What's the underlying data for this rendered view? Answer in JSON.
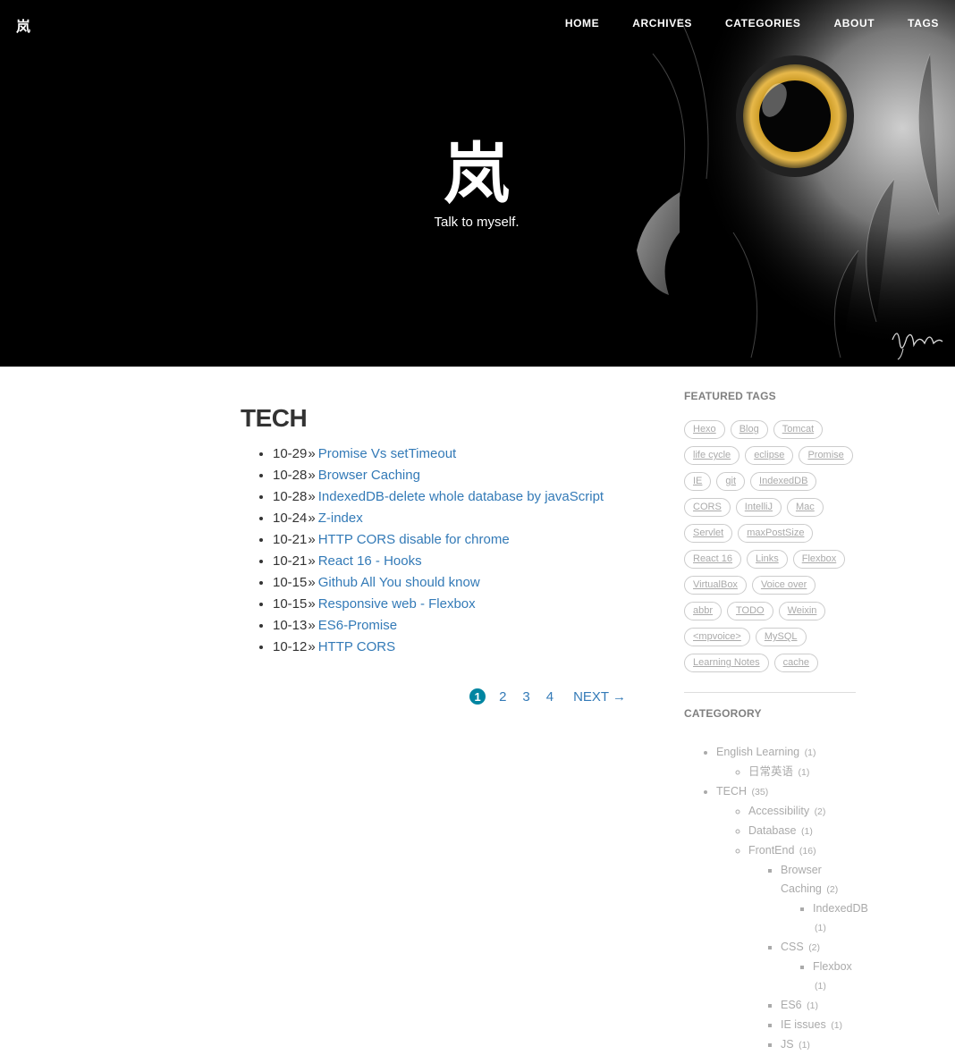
{
  "header": {
    "brand": "岚",
    "nav": [
      "HOME",
      "ARCHIVES",
      "CATEGORIES",
      "ABOUT",
      "TAGS"
    ],
    "title": "岚",
    "subtitle": "Talk to myself."
  },
  "main": {
    "heading": "TECH",
    "posts": [
      {
        "date": "10-29",
        "title": "Promise Vs setTimeout"
      },
      {
        "date": "10-28",
        "title": "Browser Caching"
      },
      {
        "date": "10-28",
        "title": "IndexedDB-delete whole database by javaScript"
      },
      {
        "date": "10-24",
        "title": "Z-index"
      },
      {
        "date": "10-21",
        "title": "HTTP CORS disable for chrome"
      },
      {
        "date": "10-21",
        "title": "React 16 - Hooks"
      },
      {
        "date": "10-15",
        "title": "Github All You should know"
      },
      {
        "date": "10-15",
        "title": "Responsive web - Flexbox"
      },
      {
        "date": "10-13",
        "title": "ES6-Promise"
      },
      {
        "date": "10-12",
        "title": "HTTP CORS"
      }
    ],
    "separator": "»"
  },
  "pagination": {
    "current": "1",
    "pages": [
      "2",
      "3",
      "4"
    ],
    "next": "NEXT →"
  },
  "sidebar": {
    "tags_heading": "FEATURED TAGS",
    "tags": [
      "Hexo",
      "Blog",
      "Tomcat",
      "life cycle",
      "eclipse",
      "Promise",
      "IE",
      "git",
      "IndexedDB",
      "CORS",
      "IntelliJ",
      "Mac",
      "Servlet",
      "maxPostSize",
      "React 16",
      "Links",
      "Flexbox",
      "VirtualBox",
      "Voice over",
      "abbr",
      "TODO",
      "Weixin",
      "<mpvoice>",
      "MySQL",
      "Learning Notes",
      "cache"
    ],
    "category_heading": "CATEGORORY",
    "categories": {
      "english": {
        "name": "English Learning",
        "count": "(1)"
      },
      "english_daily": {
        "name": "日常英语",
        "count": "(1)"
      },
      "tech": {
        "name": "TECH",
        "count": "(35)"
      },
      "accessibility": {
        "name": "Accessibility",
        "count": "(2)"
      },
      "database": {
        "name": "Database",
        "count": "(1)"
      },
      "frontend": {
        "name": "FrontEnd",
        "count": "(16)"
      },
      "browser_line1": "Browser",
      "browser_line2": "Caching",
      "browser_count": "(2)",
      "indexeddb": {
        "name": "IndexedDB",
        "count": "(1)"
      },
      "css": {
        "name": "CSS",
        "count": "(2)"
      },
      "flexbox": {
        "name": "Flexbox",
        "count": "(1)"
      },
      "es6": {
        "name": "ES6",
        "count": "(1)"
      },
      "ieissues": {
        "name": "IE issues",
        "count": "(1)"
      },
      "js": {
        "name": "JS",
        "count": "(1)"
      }
    }
  }
}
